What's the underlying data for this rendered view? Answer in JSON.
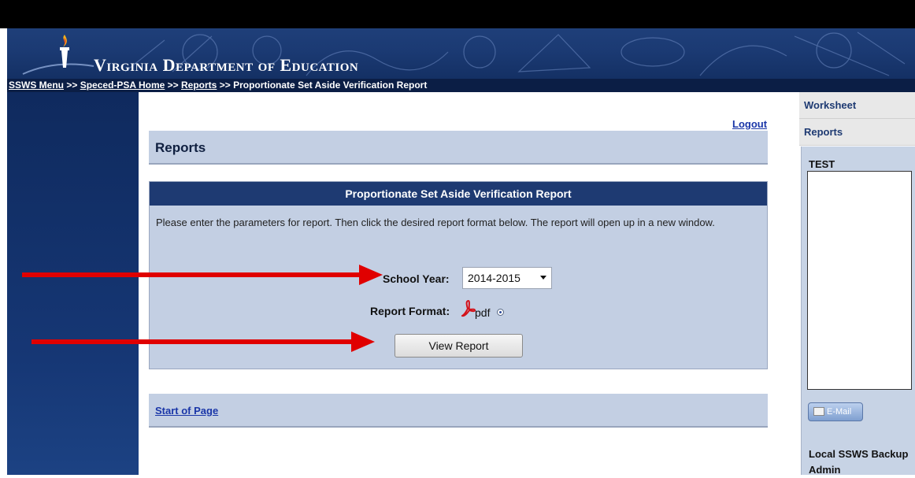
{
  "banner": {
    "title": "Virginia Department of Education"
  },
  "breadcrumb": {
    "items": [
      {
        "label": "SSWS Menu",
        "link": true
      },
      {
        "label": "Speced-PSA Home",
        "link": true
      },
      {
        "label": "Reports",
        "link": true
      },
      {
        "label": "Proportionate Set Aside Verification Report",
        "link": false
      }
    ],
    "separator": ">>"
  },
  "header": {
    "logout": "Logout",
    "page_title": "Reports"
  },
  "report_panel": {
    "title": "Proportionate Set Aside Verification Report",
    "description": "Please enter the parameters for report. Then click the desired report format below. The report will open up in a new window.",
    "school_year_label": "School Year:",
    "school_year_value": "2014-2015",
    "report_format_label": "Report Format:",
    "report_format_option": "pdf",
    "view_button": "View Report"
  },
  "footer": {
    "start_of_page": "Start of Page"
  },
  "right_sidebar": {
    "items": [
      {
        "label": "Worksheet"
      },
      {
        "label": "Reports"
      }
    ],
    "panel_title": "TEST",
    "email_button": "E-Mail",
    "backup_label": "Local SSWS Backup Admin"
  },
  "colors": {
    "banner": "#1b3a73",
    "panel_bg": "#c3cfe3",
    "panel_header": "#1e3a72",
    "link": "#1a36a8",
    "arrow": "#e00000"
  }
}
